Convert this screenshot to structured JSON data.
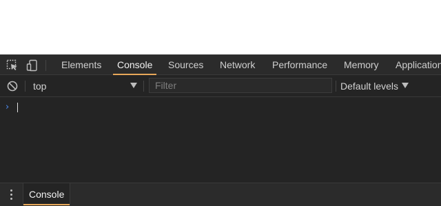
{
  "tabs": [
    {
      "label": "Elements"
    },
    {
      "label": "Console"
    },
    {
      "label": "Sources"
    },
    {
      "label": "Network"
    },
    {
      "label": "Performance"
    },
    {
      "label": "Memory"
    },
    {
      "label": "Application"
    }
  ],
  "active_tab": "Console",
  "toolbar_icons": [
    "inspect-element-icon",
    "device-toolbar-icon"
  ],
  "toolbar": {
    "context": "top",
    "filter_placeholder": "Filter",
    "filter_value": "",
    "levels_label": "Default levels"
  },
  "console": {
    "prompt_symbol": "›",
    "input_value": ""
  },
  "drawer": {
    "tab_label": "Console"
  },
  "colors": {
    "background": "#242424",
    "accent": "#e8a85a",
    "prompt": "#4f8ff7"
  }
}
